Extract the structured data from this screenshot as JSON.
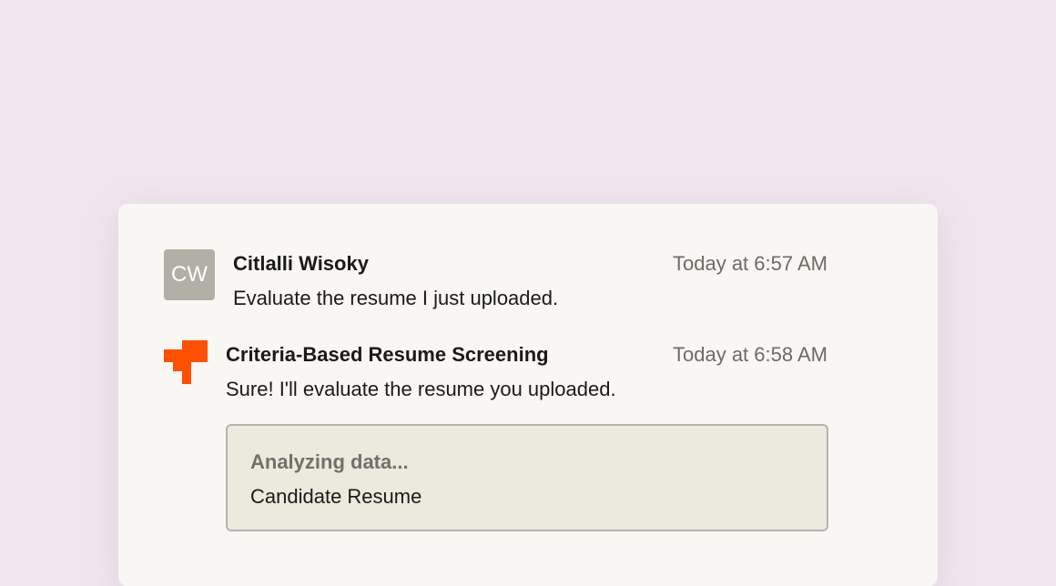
{
  "messages": {
    "user": {
      "initials": "CW",
      "sender": "Citlalli Wisoky",
      "time": "Today at 6:57 AM",
      "text": "Evaluate the resume I just uploaded."
    },
    "bot": {
      "logo_icon": "orange-cross-logo-icon",
      "sender": "Criteria-Based Resume Screening",
      "time": "Today at 6:58 AM",
      "text": "Sure! I'll evaluate the resume you uploaded.",
      "status": {
        "title": "Analyzing data...",
        "item": "Candidate Resume"
      }
    }
  },
  "colors": {
    "page_background": "#f1e6ef",
    "card_background": "#f8f7f4",
    "avatar_background": "#b1afa6",
    "brand_orange": "#ff4f00",
    "status_background": "#ece9dd"
  }
}
